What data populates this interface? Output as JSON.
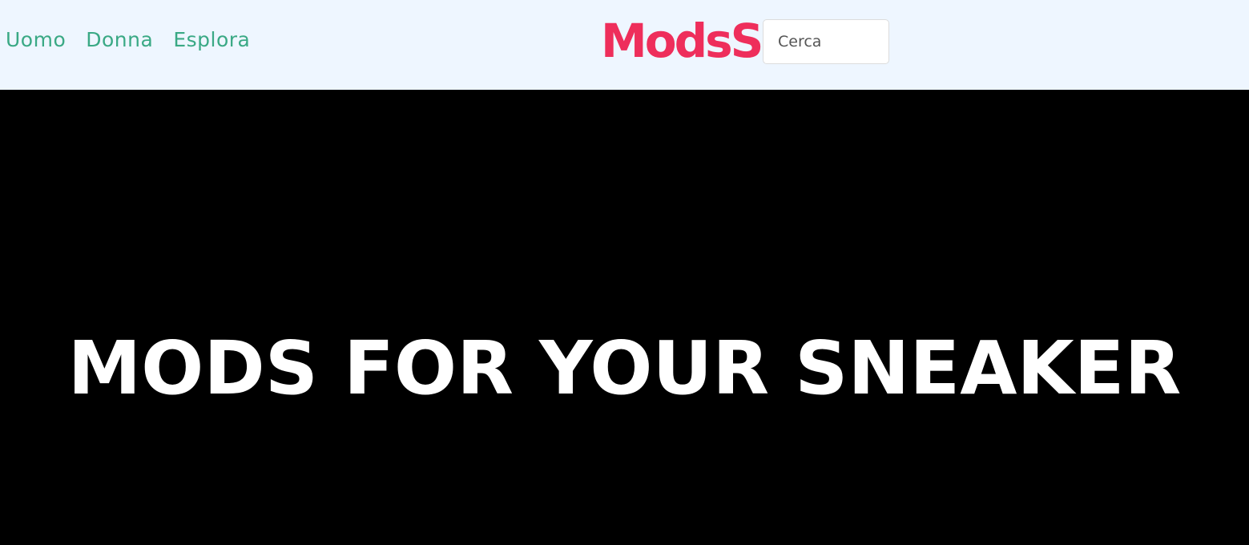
{
  "nav": {
    "links": [
      {
        "label": "Uomo"
      },
      {
        "label": "Donna"
      },
      {
        "label": "Esplora"
      }
    ]
  },
  "brand": {
    "name": "ModsS",
    "color": "#ee2e5b"
  },
  "search": {
    "placeholder": "Cerca",
    "value": ""
  },
  "hero": {
    "title": "MODS FOR YOUR SNEAKER",
    "background": "#000000",
    "text_color": "#ffffff"
  },
  "colors": {
    "nav_background": "#eef6ff",
    "nav_link": "#3aa985"
  }
}
